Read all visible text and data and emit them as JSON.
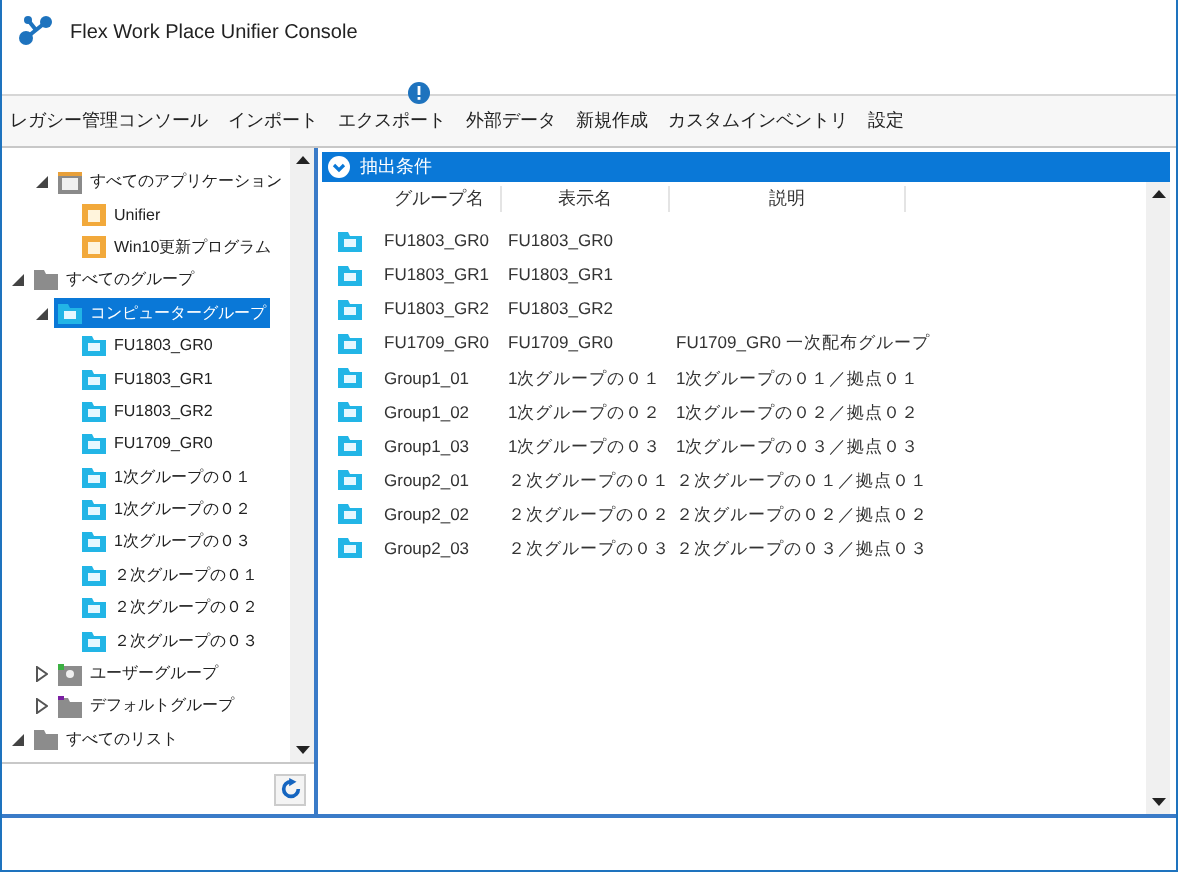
{
  "window": {
    "title": "Flex Work Place Unifier Console"
  },
  "menu": [
    {
      "label": "レガシー管理コンソール",
      "alert": false
    },
    {
      "label": "インポート",
      "alert": false
    },
    {
      "label": "エクスポート",
      "alert": true
    },
    {
      "label": "外部データ",
      "alert": false
    },
    {
      "label": "新規作成",
      "alert": false
    },
    {
      "label": "カスタムインベントリ",
      "alert": false
    },
    {
      "label": "設定",
      "alert": false
    }
  ],
  "tree": [
    {
      "children": [
        {
          "label": "すべてのアプリケーション",
          "kind": "app",
          "expanded": true,
          "selected": false,
          "children": [
            {
              "label": "Unifier",
              "kind": "app-item",
              "selected": false
            },
            {
              "label": "Win10更新プログラム",
              "kind": "app-item",
              "selected": false
            }
          ]
        }
      ]
    },
    {
      "label": "すべてのグループ",
      "kind": "folder",
      "expanded": true,
      "selected": false,
      "children": [
        {
          "label": "コンピューターグループ",
          "kind": "computer-group",
          "expanded": true,
          "selected": true,
          "children": [
            {
              "label": "FU1803_GR0",
              "kind": "computer-group",
              "selected": false
            },
            {
              "label": "FU1803_GR1",
              "kind": "computer-group",
              "selected": false
            },
            {
              "label": "FU1803_GR2",
              "kind": "computer-group",
              "selected": false
            },
            {
              "label": "FU1709_GR0",
              "kind": "computer-group",
              "selected": false
            },
            {
              "label": "1次グループの０１",
              "kind": "computer-group",
              "selected": false
            },
            {
              "label": "1次グループの０２",
              "kind": "computer-group",
              "selected": false
            },
            {
              "label": "1次グループの０３",
              "kind": "computer-group",
              "selected": false
            },
            {
              "label": "２次グループの０１",
              "kind": "computer-group",
              "selected": false
            },
            {
              "label": "２次グループの０２",
              "kind": "computer-group",
              "selected": false
            },
            {
              "label": "２次グループの０３",
              "kind": "computer-group",
              "selected": false
            }
          ]
        },
        {
          "label": "ユーザーグループ",
          "kind": "user-group",
          "expanded": false,
          "selected": false
        },
        {
          "label": "デフォルトグループ",
          "kind": "default-group",
          "expanded": false,
          "selected": false
        }
      ]
    },
    {
      "label": "すべてのリスト",
      "kind": "folder",
      "expanded": true,
      "selected": false
    }
  ],
  "filter_bar": {
    "label": "抽出条件",
    "expanded": false
  },
  "table": {
    "columns": [
      "グループ名",
      "表示名",
      "説明"
    ],
    "rows": [
      {
        "group_name": "FU1803_GR0",
        "display_name": "FU1803_GR0"
      },
      {
        "group_name": "FU1803_GR1",
        "display_name": "FU1803_GR1"
      },
      {
        "group_name": "FU1803_GR2",
        "display_name": "FU1803_GR2"
      },
      {
        "group_name": "FU1709_GR0",
        "display_name": "FU1709_GR0",
        "description": "FU1709_GR0 一次配布グループ"
      },
      {
        "group_name": "Group1_01",
        "display_name": "1次グループの０１",
        "description": "1次グループの０１／拠点０１"
      },
      {
        "group_name": "Group1_02",
        "display_name": "1次グループの０２",
        "description": "1次グループの０２／拠点０２"
      },
      {
        "group_name": "Group1_03",
        "display_name": "1次グループの０３",
        "description": "1次グループの０３／拠点０３"
      },
      {
        "group_name": "Group2_01",
        "display_name": "２次グループの０１",
        "description": "２次グループの０１／拠点０１"
      },
      {
        "group_name": "Group2_02",
        "display_name": "２次グループの０２",
        "description": "２次グループの０２／拠点０２"
      },
      {
        "group_name": "Group2_03",
        "display_name": "２次グループの０３",
        "description": "２次グループの０３／拠点０３"
      }
    ]
  }
}
